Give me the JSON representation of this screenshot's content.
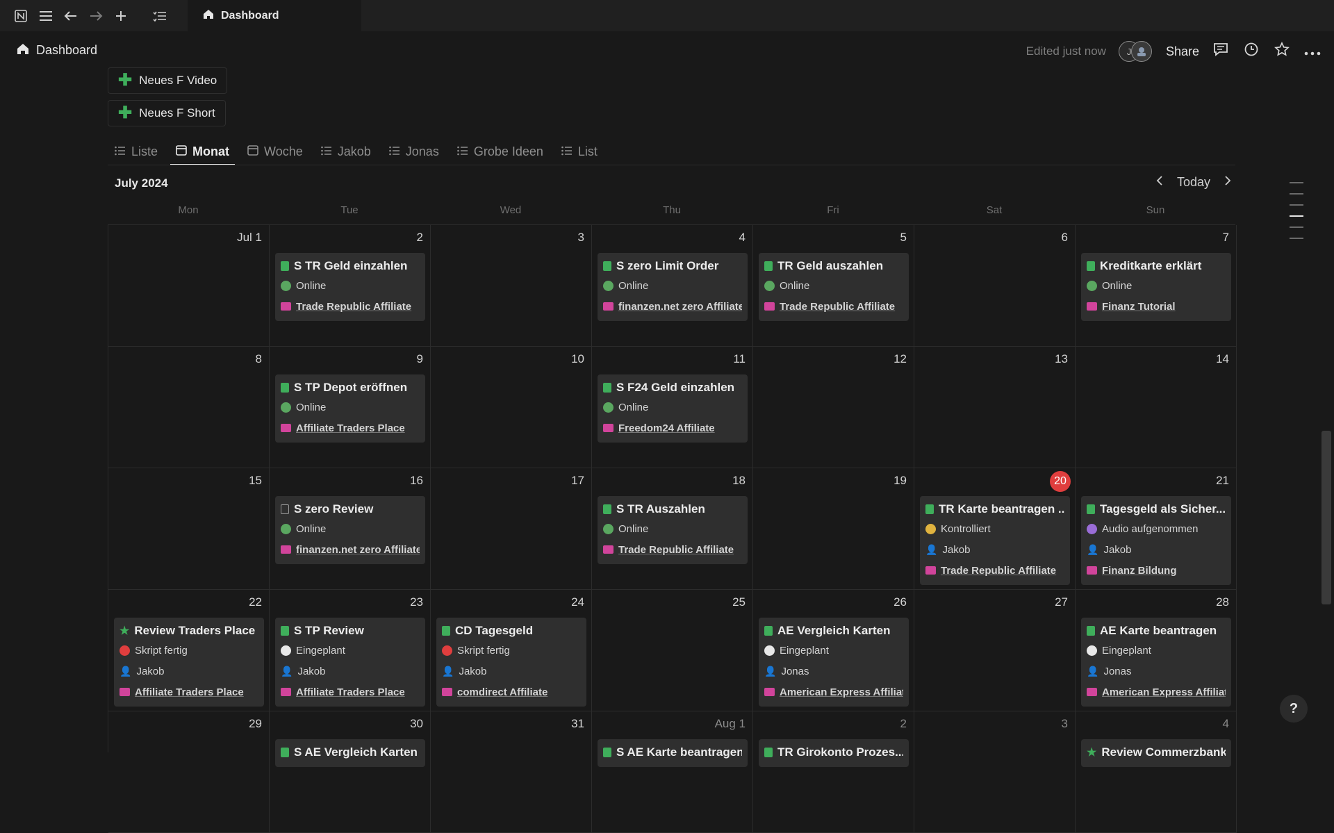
{
  "tab_title": "Dashboard",
  "breadcrumb": "Dashboard",
  "header": {
    "edited": "Edited just now",
    "avatar_initial": "J",
    "share": "Share"
  },
  "buttons": {
    "new_video": "Neues F Video",
    "new_short": "Neues F Short"
  },
  "views": [
    {
      "label": "Liste",
      "icon": "list-icon"
    },
    {
      "label": "Monat",
      "icon": "calendar-icon",
      "active": true
    },
    {
      "label": "Woche",
      "icon": "calendar-icon"
    },
    {
      "label": "Jakob",
      "icon": "list-icon"
    },
    {
      "label": "Jonas",
      "icon": "list-icon"
    },
    {
      "label": "Grobe Ideen",
      "icon": "list-icon"
    },
    {
      "label": "List",
      "icon": "list-icon"
    }
  ],
  "calendar": {
    "month_label": "July 2024",
    "today_label": "Today",
    "weekdays": [
      "Mon",
      "Tue",
      "Wed",
      "Thu",
      "Fri",
      "Sat",
      "Sun"
    ],
    "weeks": [
      [
        {
          "day": "Jul 1"
        },
        {
          "day": "2",
          "event": {
            "icon": "green",
            "title": "S TR Geld einzahlen",
            "props": [
              {
                "t": "status",
                "color": "#5aa760",
                "text": "Online"
              },
              {
                "t": "aff",
                "text": "Trade Republic Affiliate"
              }
            ]
          }
        },
        {
          "day": "3"
        },
        {
          "day": "4",
          "event": {
            "icon": "green",
            "title": "S zero Limit Order",
            "props": [
              {
                "t": "status",
                "color": "#5aa760",
                "text": "Online"
              },
              {
                "t": "aff",
                "text": "finanzen.net zero Affiliate"
              }
            ]
          }
        },
        {
          "day": "5",
          "event": {
            "icon": "green",
            "title": "TR Geld auszahlen",
            "props": [
              {
                "t": "status",
                "color": "#5aa760",
                "text": "Online"
              },
              {
                "t": "aff",
                "text": "Trade Republic Affiliate"
              }
            ]
          }
        },
        {
          "day": "6"
        },
        {
          "day": "7",
          "event": {
            "icon": "green",
            "title": "Kreditkarte erklärt",
            "props": [
              {
                "t": "status",
                "color": "#5aa760",
                "text": "Online"
              },
              {
                "t": "aff",
                "text": "Finanz Tutorial"
              }
            ]
          }
        }
      ],
      [
        {
          "day": "8"
        },
        {
          "day": "9",
          "event": {
            "icon": "green",
            "title": "S TP Depot eröffnen",
            "props": [
              {
                "t": "status",
                "color": "#5aa760",
                "text": "Online"
              },
              {
                "t": "aff",
                "text": "Affiliate Traders Place"
              }
            ]
          }
        },
        {
          "day": "10"
        },
        {
          "day": "11",
          "event": {
            "icon": "green",
            "title": "S F24 Geld einzahlen",
            "props": [
              {
                "t": "status",
                "color": "#5aa760",
                "text": "Online"
              },
              {
                "t": "aff",
                "text": "Freedom24 Affiliate"
              }
            ]
          }
        },
        {
          "day": "12"
        },
        {
          "day": "13"
        },
        {
          "day": "14"
        }
      ],
      [
        {
          "day": "15"
        },
        {
          "day": "16",
          "event": {
            "icon": "doc",
            "title": "S zero Review",
            "props": [
              {
                "t": "status",
                "color": "#5aa760",
                "text": "Online"
              },
              {
                "t": "aff",
                "text": "finanzen.net zero Affiliate"
              }
            ]
          }
        },
        {
          "day": "17"
        },
        {
          "day": "18",
          "event": {
            "icon": "green",
            "title": "S TR Auszahlen",
            "props": [
              {
                "t": "status",
                "color": "#5aa760",
                "text": "Online"
              },
              {
                "t": "aff",
                "text": "Trade Republic Affiliate"
              }
            ]
          }
        },
        {
          "day": "19"
        },
        {
          "day": "20",
          "today": true,
          "event": {
            "icon": "green",
            "title": "TR Karte beantragen ...",
            "props": [
              {
                "t": "status",
                "color": "#e0b33f",
                "text": "Kontrolliert"
              },
              {
                "t": "person",
                "text": "Jakob"
              },
              {
                "t": "aff",
                "text": "Trade Republic Affiliate"
              }
            ]
          }
        },
        {
          "day": "21",
          "event": {
            "icon": "green",
            "title": "Tagesgeld als Sicher...",
            "props": [
              {
                "t": "status",
                "color": "#9a6dd7",
                "text": "Audio aufgenommen"
              },
              {
                "t": "person",
                "text": "Jakob"
              },
              {
                "t": "aff",
                "text": "Finanz Bildung"
              }
            ]
          }
        }
      ],
      [
        {
          "day": "22",
          "event": {
            "icon": "star",
            "title": "Review Traders Place",
            "props": [
              {
                "t": "status",
                "color": "#e03e3e",
                "text": "Skript fertig"
              },
              {
                "t": "person",
                "text": "Jakob"
              },
              {
                "t": "aff",
                "text": "Affiliate Traders Place"
              }
            ]
          }
        },
        {
          "day": "23",
          "event": {
            "icon": "green",
            "title": "S TP Review",
            "props": [
              {
                "t": "status",
                "color": "#e8e8e8",
                "text": "Eingeplant"
              },
              {
                "t": "person",
                "text": "Jakob"
              },
              {
                "t": "aff",
                "text": "Affiliate Traders Place"
              }
            ]
          }
        },
        {
          "day": "24",
          "event": {
            "icon": "green",
            "title": "CD Tagesgeld",
            "props": [
              {
                "t": "status",
                "color": "#e03e3e",
                "text": "Skript fertig"
              },
              {
                "t": "person",
                "text": "Jakob"
              },
              {
                "t": "aff",
                "text": "comdirect Affiliate"
              }
            ]
          }
        },
        {
          "day": "25"
        },
        {
          "day": "26",
          "event": {
            "icon": "green",
            "title": "AE Vergleich Karten",
            "props": [
              {
                "t": "status",
                "color": "#e8e8e8",
                "text": "Eingeplant"
              },
              {
                "t": "person",
                "text": "Jonas"
              },
              {
                "t": "aff",
                "text": "American Express Affiliate"
              }
            ]
          }
        },
        {
          "day": "27"
        },
        {
          "day": "28",
          "event": {
            "icon": "green",
            "title": "AE Karte beantragen",
            "props": [
              {
                "t": "status",
                "color": "#e8e8e8",
                "text": "Eingeplant"
              },
              {
                "t": "person",
                "text": "Jonas"
              },
              {
                "t": "aff",
                "text": "American Express Affiliate"
              }
            ]
          }
        }
      ],
      [
        {
          "day": "29"
        },
        {
          "day": "30",
          "event": {
            "icon": "green",
            "title": "S AE Vergleich Karten",
            "props": []
          }
        },
        {
          "day": "31"
        },
        {
          "day": "Aug 1",
          "other": true,
          "event": {
            "icon": "green",
            "title": "S AE Karte beantragen",
            "props": []
          }
        },
        {
          "day": "2",
          "other": true,
          "event": {
            "icon": "green",
            "title": "TR Girokonto Prozes...",
            "props": []
          }
        },
        {
          "day": "3",
          "other": true
        },
        {
          "day": "4",
          "other": true,
          "event": {
            "icon": "star",
            "title": "Review Commerzbank",
            "props": []
          }
        }
      ]
    ]
  },
  "colors": {
    "accent_green": "#3fae5b",
    "today_red": "#e03e3e",
    "affiliate_pink": "#d1449b"
  },
  "help_label": "?"
}
